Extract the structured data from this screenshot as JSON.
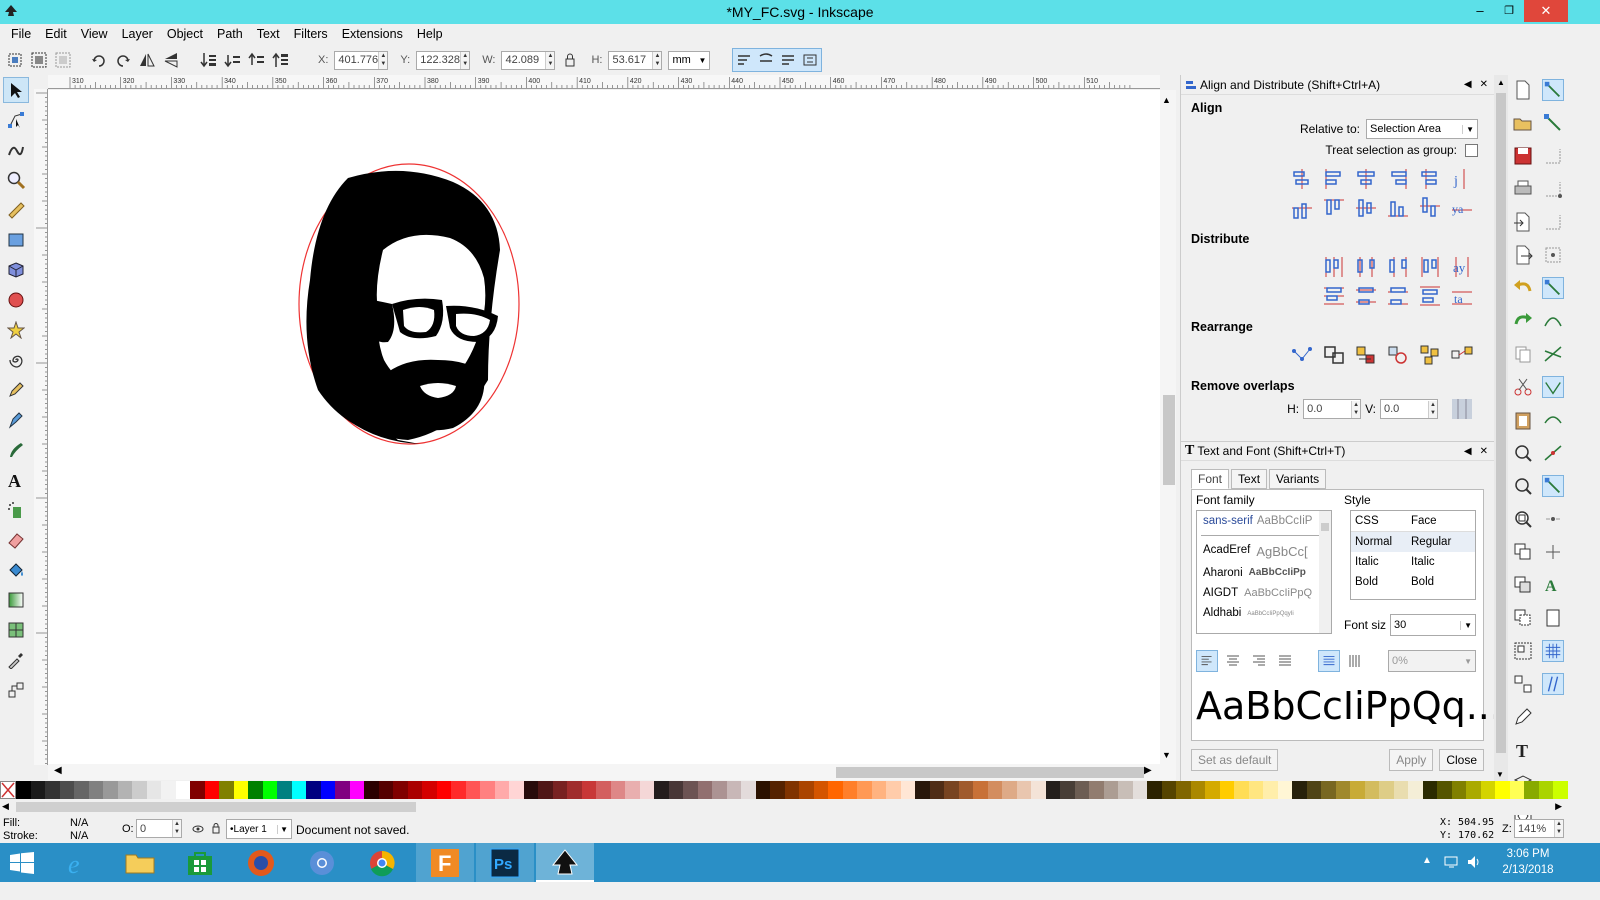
{
  "window": {
    "title": "*MY_FC.svg - Inkscape",
    "minimize": "–",
    "maximize": "❐",
    "close": "✕"
  },
  "menu": [
    "File",
    "Edit",
    "View",
    "Layer",
    "Object",
    "Path",
    "Text",
    "Filters",
    "Extensions",
    "Help"
  ],
  "toolbar": {
    "x_label": "X:",
    "x_value": "401.776",
    "y_label": "Y:",
    "y_value": "122.328",
    "w_label": "W:",
    "w_value": "42.089",
    "h_label": "H:",
    "h_value": "53.617",
    "unit": "mm"
  },
  "ruler_ticks": [
    "310",
    "320",
    "330",
    "340",
    "350",
    "360",
    "370",
    "380",
    "390",
    "400",
    "410",
    "420",
    "430",
    "440",
    "450",
    "460",
    "470",
    "480",
    "490",
    "500",
    "510"
  ],
  "align_panel": {
    "title": "Align and Distribute (Shift+Ctrl+A)",
    "align_heading": "Align",
    "relative_to_label": "Relative to:",
    "relative_to_value": "Selection Area",
    "treat_group_label": "Treat selection as group:",
    "distribute_heading": "Distribute",
    "rearrange_heading": "Rearrange",
    "remove_overlaps_heading": "Remove overlaps",
    "h_label": "H:",
    "h_value": "0.0",
    "v_label": "V:",
    "v_value": "0.0"
  },
  "text_panel": {
    "title": "Text and Font (Shift+Ctrl+T)",
    "tabs": [
      "Font",
      "Text",
      "Variants"
    ],
    "font_family_label": "Font family",
    "style_label": "Style",
    "fonts": [
      {
        "name": "sans-serif",
        "sample": "AaBbCcIiP"
      },
      {
        "name": "AcadEref",
        "sample": "AgBbCc["
      },
      {
        "name": "Aharoni",
        "sample": "AaBbCcIiPp"
      },
      {
        "name": "AIGDT",
        "sample": "AaBbCcIiPpQ"
      },
      {
        "name": "Aldhabi",
        "sample": "AaBbCcIiPpQqyIi"
      }
    ],
    "style_headers": [
      "CSS",
      "Face"
    ],
    "styles": [
      {
        "css": "Normal",
        "face": "Regular"
      },
      {
        "css": "Italic",
        "face": "Italic"
      },
      {
        "css": "Bold",
        "face": "Bold"
      }
    ],
    "font_size_label": "Font siz",
    "font_size_value": "30",
    "spacing_value": "0%",
    "preview": "AaBbCcIiPpQq...",
    "set_default": "Set as default",
    "apply": "Apply",
    "close": "Close"
  },
  "status": {
    "fill_label": "Fill:",
    "fill_value": "N/A",
    "stroke_label": "Stroke:",
    "stroke_value": "N/A",
    "opacity_label": "O:",
    "opacity_value": "0",
    "layer": "•Layer 1",
    "message": "Document not saved.",
    "cursor_x": "X: 504.95",
    "cursor_y": "Y: 170.62",
    "zoom_label": "Z:",
    "zoom_value": "141%"
  },
  "taskbar": {
    "time": "3:06 PM",
    "date": "2/13/2018"
  },
  "palette": [
    "#000000",
    "#1a1a1a",
    "#333333",
    "#4d4d4d",
    "#666666",
    "#808080",
    "#999999",
    "#b3b3b3",
    "#cccccc",
    "#e6e6e6",
    "#f2f2f2",
    "#ffffff",
    "#800000",
    "#ff0000",
    "#808000",
    "#ffff00",
    "#008000",
    "#00ff00",
    "#008080",
    "#00ffff",
    "#000080",
    "#0000ff",
    "#800080",
    "#ff00ff",
    "#2b0000",
    "#550000",
    "#800000",
    "#aa0000",
    "#d40000",
    "#ff0000",
    "#ff2a2a",
    "#ff5555",
    "#ff8080",
    "#ffaaaa",
    "#ffd5d5",
    "#280b0b",
    "#501616",
    "#782121",
    "#a02c2c",
    "#c83737",
    "#d35f5f",
    "#de8787",
    "#e9afaf",
    "#f4d7d7",
    "#241c1c",
    "#483737",
    "#6c5353",
    "#916f6f",
    "#ac9393",
    "#c8b7b7",
    "#e3dbdb",
    "#2b1100",
    "#552200",
    "#803300",
    "#aa4400",
    "#d45500",
    "#ff6600",
    "#ff7f2a",
    "#ff9955",
    "#ffb380",
    "#ffccaa",
    "#ffe6d5",
    "#28170b",
    "#502d16",
    "#784421",
    "#a05a2c",
    "#c87137",
    "#d38d5f",
    "#deaa87",
    "#e9c6af",
    "#f4e3d7",
    "#241f1c",
    "#483e37",
    "#6c5d53",
    "#917c6f",
    "#ac9d93",
    "#c8beb7",
    "#e3dedb",
    "#2b2200",
    "#554400",
    "#806600",
    "#aa8800",
    "#d4aa00",
    "#ffcc00",
    "#ffdd55",
    "#ffe680",
    "#ffeeaa",
    "#fff6d5",
    "#28220b",
    "#504416",
    "#786721",
    "#a0892c",
    "#c8ab37",
    "#d3bc5f",
    "#decd87",
    "#e9ddaf",
    "#f4eed7",
    "#2b2b00",
    "#555500",
    "#808000",
    "#aaaa00",
    "#d4d400",
    "#ffff00",
    "#ffff55",
    "#88aa00",
    "#aad400",
    "#ccff00"
  ]
}
